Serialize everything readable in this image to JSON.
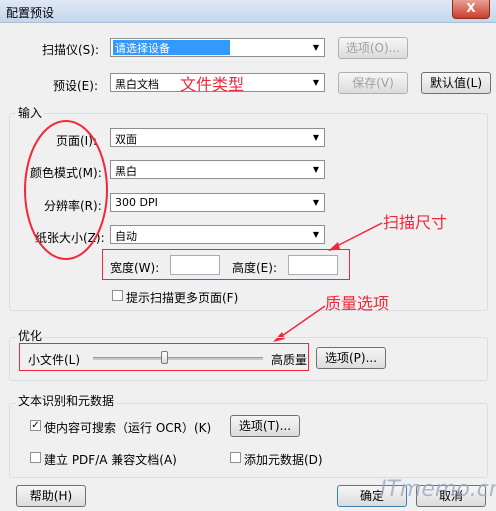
{
  "window": {
    "title": "配置预设",
    "close_label": "X"
  },
  "scanner": {
    "label": "扫描仪(S):",
    "value": "请选择设备",
    "options_btn": "选项(O)..."
  },
  "preset": {
    "label": "预设(E):",
    "value": "黑白文档",
    "save_btn": "保存(V)",
    "default_btn": "默认值(L)"
  },
  "annotations": {
    "file_type": "文件类型",
    "scan_size": "扫描尺寸",
    "quality": "质量选项"
  },
  "input_group": {
    "title": "输入",
    "page_label": "页面(I):",
    "page_value": "双面",
    "color_label": "颜色模式(M):",
    "color_value": "黑白",
    "resolution_label": "分辨率(R):",
    "resolution_value": "300 DPI",
    "paper_label": "纸张大小(Z):",
    "paper_value": "自动",
    "width_label": "宽度(W):",
    "width_value": "",
    "height_label": "高度(E):",
    "height_value": "",
    "prompt_more_pages": "提示扫描更多页面(F)",
    "prompt_more_pages_checked": false
  },
  "optimize_group": {
    "title": "优化",
    "small_label": "小文件(L)",
    "high_label": "高质量",
    "slider_position": 0.42,
    "options_btn": "选项(P)..."
  },
  "ocr_group": {
    "title": "文本识别和元数据",
    "searchable_label": "使内容可搜索（运行 OCR）(K)",
    "searchable_checked": true,
    "options_btn": "选项(T)...",
    "pdfa_label": "建立 PDF/A 兼容文档(A)",
    "pdfa_checked": false,
    "metadata_label": "添加元数据(D)",
    "metadata_checked": false
  },
  "footer": {
    "help_btn": "帮助(H)",
    "ok_btn": "确定",
    "cancel_btn": "取消"
  },
  "watermark": "ITmemo.cn",
  "colors": {
    "annotation": "#f0283a",
    "selection": "#3399ff"
  }
}
